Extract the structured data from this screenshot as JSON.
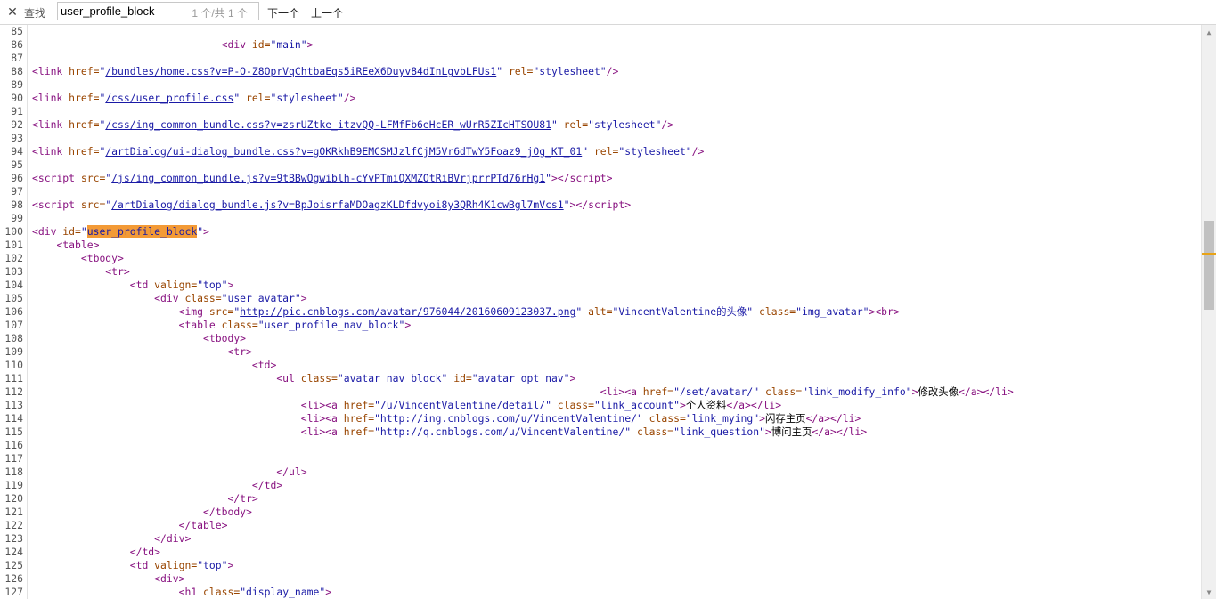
{
  "findbar": {
    "close_glyph": "✕",
    "label": "查找",
    "query": "user_profile_block",
    "match_count": "1 个/共 1 个",
    "next_label": "下一个",
    "prev_label": "上一个"
  },
  "source_lines": [
    {
      "n": "85",
      "code": ""
    },
    {
      "n": "86",
      "code": "                               <span class=\"tag\">&lt;div</span> <span class=\"attr\">id=</span><span class=\"val\">\"main\"</span><span class=\"tag\">&gt;</span>"
    },
    {
      "n": "87",
      "code": ""
    },
    {
      "n": "88",
      "code": "<span class=\"tag\">&lt;link</span> <span class=\"attr\">href=</span><span class=\"val\">\"</span><span class=\"lnk\">/bundles/home.css?v=P-O-Z8OprVqChtbaEqs5iREeX6Duyv84dInLgvbLFUs1</span><span class=\"val\">\"</span> <span class=\"attr\">rel=</span><span class=\"val\">\"stylesheet\"</span><span class=\"tag\">/&gt;</span>"
    },
    {
      "n": "89",
      "code": ""
    },
    {
      "n": "90",
      "code": "<span class=\"tag\">&lt;link</span> <span class=\"attr\">href=</span><span class=\"val\">\"</span><span class=\"lnk\">/css/user_profile.css</span><span class=\"val\">\"</span> <span class=\"attr\">rel=</span><span class=\"val\">\"stylesheet\"</span><span class=\"tag\">/&gt;</span>"
    },
    {
      "n": "91",
      "code": ""
    },
    {
      "n": "92",
      "code": "<span class=\"tag\">&lt;link</span> <span class=\"attr\">href=</span><span class=\"val\">\"</span><span class=\"lnk\">/css/ing_common_bundle.css?v=zsrUZtke_itzvQQ-LFMfFb6eHcER_wUrR5ZIcHTSOU81</span><span class=\"val\">\"</span> <span class=\"attr\">rel=</span><span class=\"val\">\"stylesheet\"</span><span class=\"tag\">/&gt;</span>"
    },
    {
      "n": "93",
      "code": ""
    },
    {
      "n": "94",
      "code": "<span class=\"tag\">&lt;link</span> <span class=\"attr\">href=</span><span class=\"val\">\"</span><span class=\"lnk\">/artDialog/ui-dialog_bundle.css?v=gOKRkhB9EMCSMJzlfCjM5Vr6dTwY5Foaz9_jOg_KT_01</span><span class=\"val\">\"</span> <span class=\"attr\">rel=</span><span class=\"val\">\"stylesheet\"</span><span class=\"tag\">/&gt;</span>"
    },
    {
      "n": "95",
      "code": ""
    },
    {
      "n": "96",
      "code": "<span class=\"tag\">&lt;script</span> <span class=\"attr\">src=</span><span class=\"val\">\"</span><span class=\"lnk\">/js/ing_common_bundle.js?v=9tBBwOgwiblh-cYvPTmiQXMZOtRiBVrjprrPTd76rHg1</span><span class=\"val\">\"</span><span class=\"tag\">&gt;&lt;/script&gt;</span>"
    },
    {
      "n": "97",
      "code": ""
    },
    {
      "n": "98",
      "code": "<span class=\"tag\">&lt;script</span> <span class=\"attr\">src=</span><span class=\"val\">\"</span><span class=\"lnk\">/artDialog/dialog_bundle.js?v=BpJoisrfaMDOagzKLDfdvyoi8y3QRh4K1cwBgl7mVcs1</span><span class=\"val\">\"</span><span class=\"tag\">&gt;&lt;/script&gt;</span>"
    },
    {
      "n": "99",
      "code": ""
    },
    {
      "n": "100",
      "code": "<span class=\"tag\">&lt;div</span> <span class=\"attr\">id=</span><span class=\"val\">\"</span><span class=\"hl\">user_profile_block</span><span class=\"val\">\"</span><span class=\"tag\">&gt;</span>"
    },
    {
      "n": "101",
      "code": "    <span class=\"tag\">&lt;table&gt;</span>"
    },
    {
      "n": "102",
      "code": "        <span class=\"tag\">&lt;tbody&gt;</span>"
    },
    {
      "n": "103",
      "code": "            <span class=\"tag\">&lt;tr&gt;</span>"
    },
    {
      "n": "104",
      "code": "                <span class=\"tag\">&lt;td</span> <span class=\"attr\">valign=</span><span class=\"val\">\"top\"</span><span class=\"tag\">&gt;</span>"
    },
    {
      "n": "105",
      "code": "                    <span class=\"tag\">&lt;div</span> <span class=\"attr\">class=</span><span class=\"val\">\"user_avatar\"</span><span class=\"tag\">&gt;</span>"
    },
    {
      "n": "106",
      "code": "                        <span class=\"tag\">&lt;img</span> <span class=\"attr\">src=</span><span class=\"val\">\"</span><span class=\"lnk\">http://pic.cnblogs.com/avatar/976044/20160609123037.png</span><span class=\"val\">\"</span> <span class=\"attr\">alt=</span><span class=\"val\">\"VincentValentine的头像\"</span> <span class=\"attr\">class=</span><span class=\"val\">\"img_avatar\"</span><span class=\"tag\">&gt;&lt;br&gt;</span>"
    },
    {
      "n": "107",
      "code": "                        <span class=\"tag\">&lt;table</span> <span class=\"attr\">class=</span><span class=\"val\">\"user_profile_nav_block\"</span><span class=\"tag\">&gt;</span>"
    },
    {
      "n": "108",
      "code": "                            <span class=\"tag\">&lt;tbody&gt;</span>"
    },
    {
      "n": "109",
      "code": "                                <span class=\"tag\">&lt;tr&gt;</span>"
    },
    {
      "n": "110",
      "code": "                                    <span class=\"tag\">&lt;td&gt;</span>"
    },
    {
      "n": "111",
      "code": "                                        <span class=\"tag\">&lt;ul</span> <span class=\"attr\">class=</span><span class=\"val\">\"avatar_nav_block\"</span> <span class=\"attr\">id=</span><span class=\"val\">\"avatar_opt_nav\"</span><span class=\"tag\">&gt;</span>"
    },
    {
      "n": "112",
      "code": "                                                                                             <span class=\"tag\">&lt;li&gt;&lt;a</span> <span class=\"attr\">href=</span><span class=\"val\">\"/set/avatar/\"</span> <span class=\"attr\">class=</span><span class=\"val\">\"link_modify_info\"</span><span class=\"tag\">&gt;</span><span class=\"txt\">修改头像</span><span class=\"tag\">&lt;/a&gt;&lt;/li&gt;</span>"
    },
    {
      "n": "113",
      "code": "                                            <span class=\"tag\">&lt;li&gt;&lt;a</span> <span class=\"attr\">href=</span><span class=\"val\">\"/u/VincentValentine/detail/\"</span> <span class=\"attr\">class=</span><span class=\"val\">\"link_account\"</span><span class=\"tag\">&gt;</span><span class=\"txt\">个人资料</span><span class=\"tag\">&lt;/a&gt;&lt;/li&gt;</span>"
    },
    {
      "n": "114",
      "code": "                                            <span class=\"tag\">&lt;li&gt;&lt;a</span> <span class=\"attr\">href=</span><span class=\"val\">\"http://ing.cnblogs.com/u/VincentValentine/\"</span> <span class=\"attr\">class=</span><span class=\"val\">\"link_mying\"</span><span class=\"tag\">&gt;</span><span class=\"txt\">闪存主页</span><span class=\"tag\">&lt;/a&gt;&lt;/li&gt;</span>"
    },
    {
      "n": "115",
      "code": "                                            <span class=\"tag\">&lt;li&gt;&lt;a</span> <span class=\"attr\">href=</span><span class=\"val\">\"http://q.cnblogs.com/u/VincentValentine/\"</span> <span class=\"attr\">class=</span><span class=\"val\">\"link_question\"</span><span class=\"tag\">&gt;</span><span class=\"txt\">博问主页</span><span class=\"tag\">&lt;/a&gt;&lt;/li&gt;</span>"
    },
    {
      "n": "116",
      "code": ""
    },
    {
      "n": "117",
      "code": ""
    },
    {
      "n": "118",
      "code": "                                        <span class=\"tag\">&lt;/ul&gt;</span>"
    },
    {
      "n": "119",
      "code": "                                    <span class=\"tag\">&lt;/td&gt;</span>"
    },
    {
      "n": "120",
      "code": "                                <span class=\"tag\">&lt;/tr&gt;</span>"
    },
    {
      "n": "121",
      "code": "                            <span class=\"tag\">&lt;/tbody&gt;</span>"
    },
    {
      "n": "122",
      "code": "                        <span class=\"tag\">&lt;/table&gt;</span>"
    },
    {
      "n": "123",
      "code": "                    <span class=\"tag\">&lt;/div&gt;</span>"
    },
    {
      "n": "124",
      "code": "                <span class=\"tag\">&lt;/td&gt;</span>"
    },
    {
      "n": "125",
      "code": "                <span class=\"tag\">&lt;td</span> <span class=\"attr\">valign=</span><span class=\"val\">\"top\"</span><span class=\"tag\">&gt;</span>"
    },
    {
      "n": "126",
      "code": "                    <span class=\"tag\">&lt;div&gt;</span>"
    },
    {
      "n": "127",
      "code": "                        <span class=\"tag\">&lt;h1</span> <span class=\"attr\">class=</span><span class=\"val\">\"display_name\"</span><span class=\"tag\">&gt;</span>"
    }
  ],
  "scrollbar": {
    "up_glyph": "▲",
    "down_glyph": "▼"
  }
}
